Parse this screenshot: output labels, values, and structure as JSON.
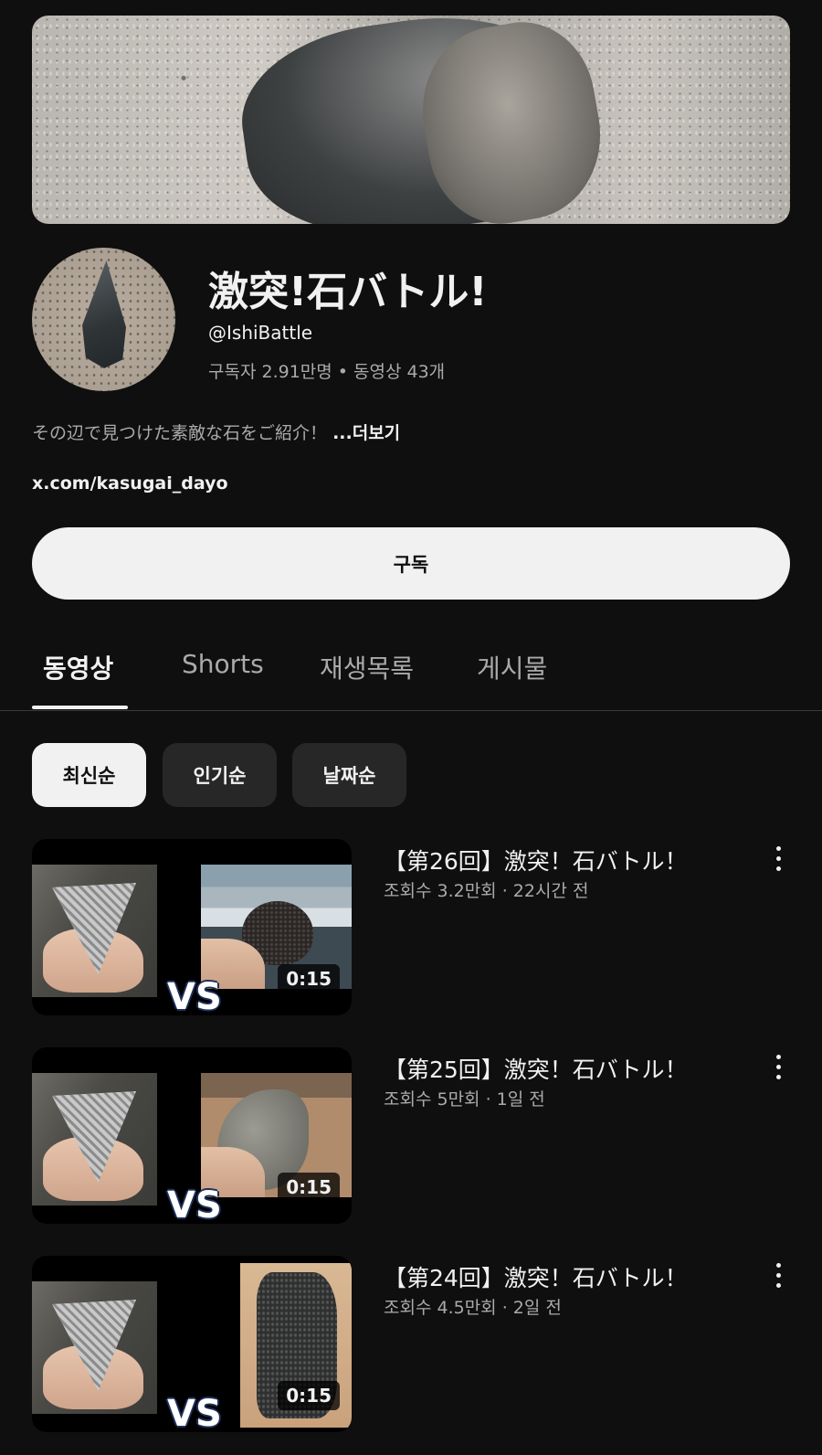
{
  "channel": {
    "title": "激突!石バトル!",
    "handle": "@IshiBattle",
    "stats": "구독자 2.91만명 • 동영상 43개",
    "description": "その辺で見つけた素敵な石をご紹介！",
    "more_label": "...더보기",
    "link": "x.com/kasugai_dayo"
  },
  "subscribe_label": "구독",
  "tabs": [
    "동영상",
    "Shorts",
    "재생목록",
    "게시물"
  ],
  "chips": [
    "최신순",
    "인기순",
    "날짜순"
  ],
  "videos": [
    {
      "title": "【第26回】激突！石バトル！",
      "meta": "조회수 3.2만회 · 22시간 전",
      "duration": "0:15",
      "vs": "VS"
    },
    {
      "title": "【第25回】激突！石バトル！",
      "meta": "조회수 5만회 · 1일 전",
      "duration": "0:15",
      "vs": "VS"
    },
    {
      "title": "【第24回】激突！石バトル！",
      "meta": "조회수 4.5만회 · 2일 전",
      "duration": "0:15",
      "vs": "VS"
    }
  ],
  "icons": [
    "more-vert-icon"
  ]
}
